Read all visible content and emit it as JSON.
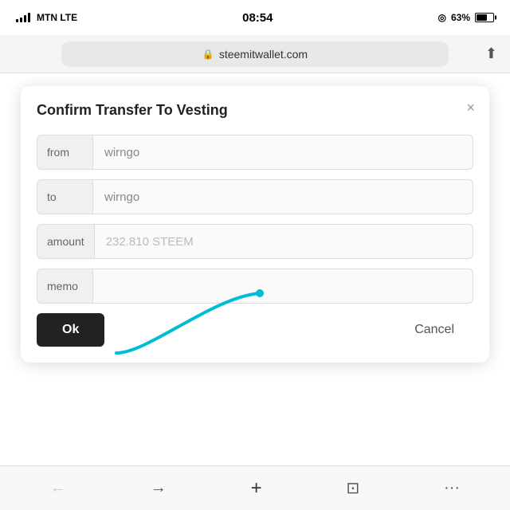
{
  "statusBar": {
    "carrier": "MTN  LTE",
    "time": "08:54",
    "battery": "63%"
  },
  "browserBar": {
    "url": "steemitwallet.com",
    "lockIcon": "🔒",
    "shareIcon": "⬆"
  },
  "modal": {
    "title": "Confirm Transfer To Vesting",
    "closeLabel": "×",
    "fields": [
      {
        "label": "from",
        "value": "wirngo",
        "placeholder": "wirngo"
      },
      {
        "label": "to",
        "value": "wirngo",
        "placeholder": "wirngo"
      },
      {
        "label": "amount",
        "value": "232.810 STEEM",
        "placeholder": "232.810 STEEM"
      },
      {
        "label": "memo",
        "value": "",
        "placeholder": ""
      }
    ],
    "okLabel": "Ok",
    "cancelLabel": "Cancel"
  },
  "bottomNav": {
    "back": "←",
    "forward": "→",
    "add": "+",
    "pages": "⊡",
    "more": "···"
  }
}
